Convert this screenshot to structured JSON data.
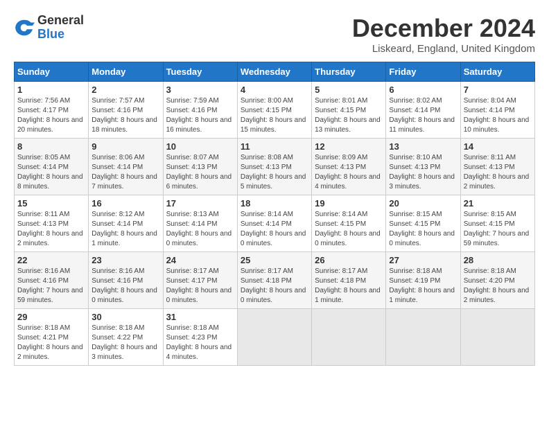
{
  "logo": {
    "general": "General",
    "blue": "Blue"
  },
  "header": {
    "month": "December 2024",
    "location": "Liskeard, England, United Kingdom"
  },
  "days_of_week": [
    "Sunday",
    "Monday",
    "Tuesday",
    "Wednesday",
    "Thursday",
    "Friday",
    "Saturday"
  ],
  "weeks": [
    [
      {
        "day": "1",
        "sunrise": "7:56 AM",
        "sunset": "4:17 PM",
        "daylight": "8 hours and 20 minutes."
      },
      {
        "day": "2",
        "sunrise": "7:57 AM",
        "sunset": "4:16 PM",
        "daylight": "8 hours and 18 minutes."
      },
      {
        "day": "3",
        "sunrise": "7:59 AM",
        "sunset": "4:16 PM",
        "daylight": "8 hours and 16 minutes."
      },
      {
        "day": "4",
        "sunrise": "8:00 AM",
        "sunset": "4:15 PM",
        "daylight": "8 hours and 15 minutes."
      },
      {
        "day": "5",
        "sunrise": "8:01 AM",
        "sunset": "4:15 PM",
        "daylight": "8 hours and 13 minutes."
      },
      {
        "day": "6",
        "sunrise": "8:02 AM",
        "sunset": "4:14 PM",
        "daylight": "8 hours and 11 minutes."
      },
      {
        "day": "7",
        "sunrise": "8:04 AM",
        "sunset": "4:14 PM",
        "daylight": "8 hours and 10 minutes."
      }
    ],
    [
      {
        "day": "8",
        "sunrise": "8:05 AM",
        "sunset": "4:14 PM",
        "daylight": "8 hours and 8 minutes."
      },
      {
        "day": "9",
        "sunrise": "8:06 AM",
        "sunset": "4:14 PM",
        "daylight": "8 hours and 7 minutes."
      },
      {
        "day": "10",
        "sunrise": "8:07 AM",
        "sunset": "4:13 PM",
        "daylight": "8 hours and 6 minutes."
      },
      {
        "day": "11",
        "sunrise": "8:08 AM",
        "sunset": "4:13 PM",
        "daylight": "8 hours and 5 minutes."
      },
      {
        "day": "12",
        "sunrise": "8:09 AM",
        "sunset": "4:13 PM",
        "daylight": "8 hours and 4 minutes."
      },
      {
        "day": "13",
        "sunrise": "8:10 AM",
        "sunset": "4:13 PM",
        "daylight": "8 hours and 3 minutes."
      },
      {
        "day": "14",
        "sunrise": "8:11 AM",
        "sunset": "4:13 PM",
        "daylight": "8 hours and 2 minutes."
      }
    ],
    [
      {
        "day": "15",
        "sunrise": "8:11 AM",
        "sunset": "4:13 PM",
        "daylight": "8 hours and 2 minutes."
      },
      {
        "day": "16",
        "sunrise": "8:12 AM",
        "sunset": "4:14 PM",
        "daylight": "8 hours and 1 minute."
      },
      {
        "day": "17",
        "sunrise": "8:13 AM",
        "sunset": "4:14 PM",
        "daylight": "8 hours and 0 minutes."
      },
      {
        "day": "18",
        "sunrise": "8:14 AM",
        "sunset": "4:14 PM",
        "daylight": "8 hours and 0 minutes."
      },
      {
        "day": "19",
        "sunrise": "8:14 AM",
        "sunset": "4:15 PM",
        "daylight": "8 hours and 0 minutes."
      },
      {
        "day": "20",
        "sunrise": "8:15 AM",
        "sunset": "4:15 PM",
        "daylight": "8 hours and 0 minutes."
      },
      {
        "day": "21",
        "sunrise": "8:15 AM",
        "sunset": "4:15 PM",
        "daylight": "7 hours and 59 minutes."
      }
    ],
    [
      {
        "day": "22",
        "sunrise": "8:16 AM",
        "sunset": "4:16 PM",
        "daylight": "7 hours and 59 minutes."
      },
      {
        "day": "23",
        "sunrise": "8:16 AM",
        "sunset": "4:16 PM",
        "daylight": "8 hours and 0 minutes."
      },
      {
        "day": "24",
        "sunrise": "8:17 AM",
        "sunset": "4:17 PM",
        "daylight": "8 hours and 0 minutes."
      },
      {
        "day": "25",
        "sunrise": "8:17 AM",
        "sunset": "4:18 PM",
        "daylight": "8 hours and 0 minutes."
      },
      {
        "day": "26",
        "sunrise": "8:17 AM",
        "sunset": "4:18 PM",
        "daylight": "8 hours and 1 minute."
      },
      {
        "day": "27",
        "sunrise": "8:18 AM",
        "sunset": "4:19 PM",
        "daylight": "8 hours and 1 minute."
      },
      {
        "day": "28",
        "sunrise": "8:18 AM",
        "sunset": "4:20 PM",
        "daylight": "8 hours and 2 minutes."
      }
    ],
    [
      {
        "day": "29",
        "sunrise": "8:18 AM",
        "sunset": "4:21 PM",
        "daylight": "8 hours and 2 minutes."
      },
      {
        "day": "30",
        "sunrise": "8:18 AM",
        "sunset": "4:22 PM",
        "daylight": "8 hours and 3 minutes."
      },
      {
        "day": "31",
        "sunrise": "8:18 AM",
        "sunset": "4:23 PM",
        "daylight": "8 hours and 4 minutes."
      },
      null,
      null,
      null,
      null
    ]
  ],
  "labels": {
    "sunrise": "Sunrise:",
    "sunset": "Sunset:",
    "daylight": "Daylight:"
  }
}
